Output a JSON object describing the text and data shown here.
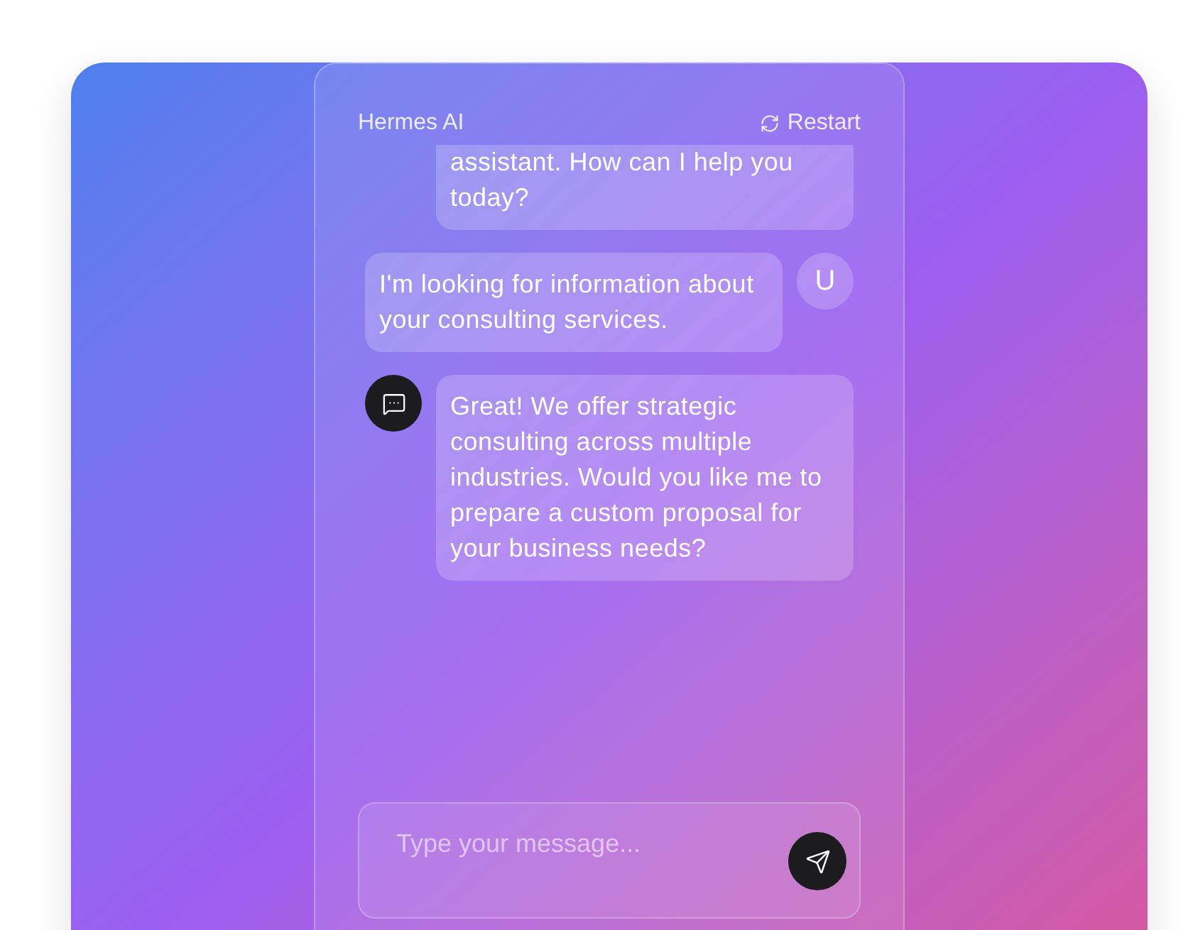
{
  "header": {
    "title": "Hermes AI",
    "restart_button": "Restart"
  },
  "messages": [
    {
      "kind": "assistant",
      "clipped": true,
      "text": "assistant. How can I help you today?"
    },
    {
      "kind": "user",
      "clipped": false,
      "avatar": "U",
      "text": "I'm looking for information about your consulting services."
    },
    {
      "kind": "assistant",
      "clipped": false,
      "text": "Great! We offer strategic consulting across multiple industries. Would you like me to prepare a custom proposal for your business needs?"
    }
  ],
  "composer": {
    "placeholder": "Type your message..."
  }
}
